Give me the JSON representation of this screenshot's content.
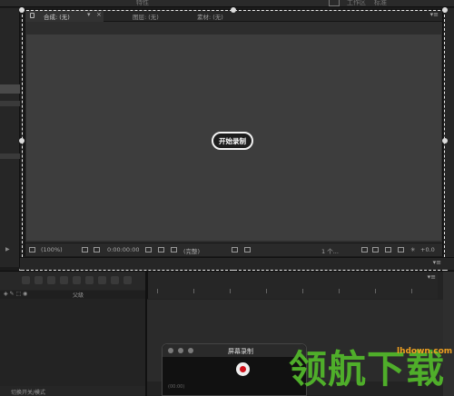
{
  "app": {
    "top_labels": [
      "特性",
      "工作区",
      "标准"
    ]
  },
  "comp_panel": {
    "tabs": [
      {
        "label": "合成: (无)",
        "active": true
      },
      {
        "label": "图层: (无)",
        "active": false
      },
      {
        "label": "素材: (无)",
        "active": false
      }
    ],
    "tab_dropdown": "▾",
    "tab_close": "×",
    "panel_menu": "▾≡"
  },
  "record_button": {
    "label": "开始录制"
  },
  "viewer_toolbar": {
    "zoom": "(100%)",
    "timecode": "0:00:00:00",
    "resolution": "(完整)",
    "view_count": "1 个...",
    "exposure": "+0.0"
  },
  "below_bar": {
    "menu": "▾≡"
  },
  "timeline": {
    "column_label": "父级",
    "status_text": "切换开关/模式",
    "ruler_menu": "▾≡"
  },
  "recorder": {
    "title": "屏幕录制",
    "footer": "(00:00)"
  },
  "watermark": {
    "logo_text": "领航下载",
    "url": "lhdown.com",
    "color_logo": "#4fae2a",
    "color_url": "#f0a020"
  },
  "colors": {
    "viewer_bg": "#3d3d3d",
    "panel_bg": "#2d2d2d",
    "record_dot": "#d0101a"
  }
}
